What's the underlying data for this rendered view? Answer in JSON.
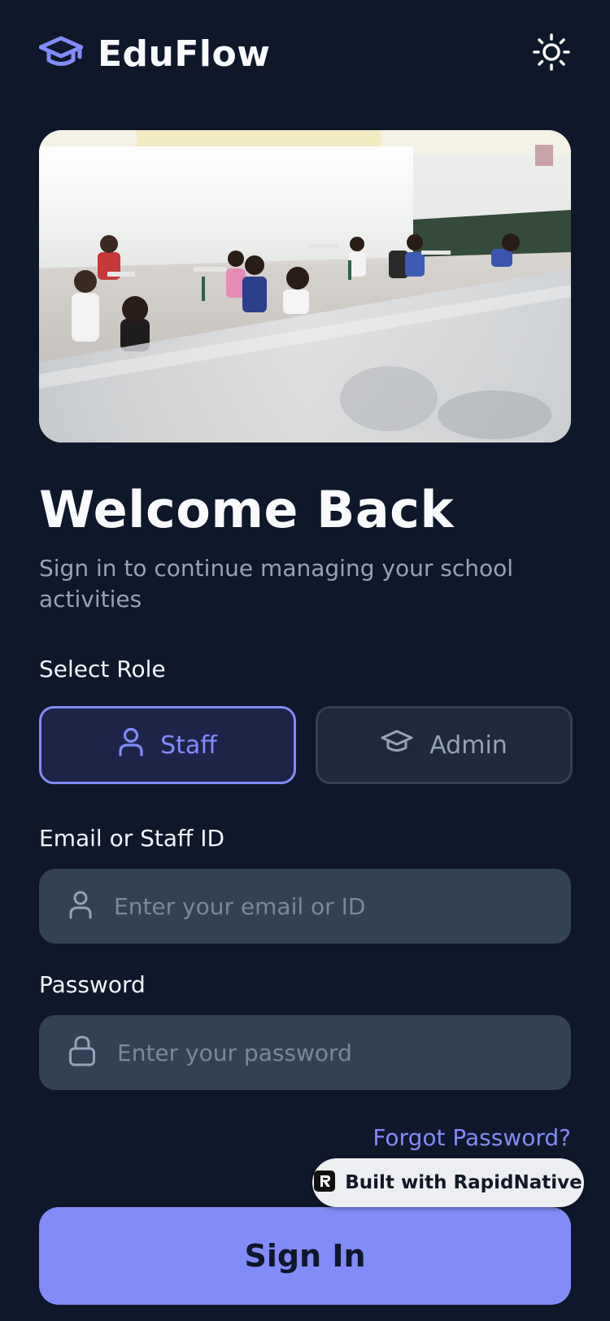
{
  "app": {
    "name": "EduFlow"
  },
  "header": {
    "logo_icon": "graduation-cap-icon",
    "theme_icon": "sun-icon"
  },
  "welcome": {
    "title": "Welcome Back",
    "subtitle": "Sign in to continue managing your school activities"
  },
  "role": {
    "label": "Select Role",
    "options": [
      {
        "label": "Staff",
        "icon": "user-icon",
        "selected": true
      },
      {
        "label": "Admin",
        "icon": "graduation-cap-icon",
        "selected": false
      }
    ]
  },
  "email": {
    "label": "Email or Staff ID",
    "placeholder": "Enter your email or ID",
    "value": "",
    "icon": "user-icon"
  },
  "password": {
    "label": "Password",
    "placeholder": "Enter your password",
    "value": "",
    "icon": "lock-icon"
  },
  "forgot_label": "Forgot Password?",
  "badge": {
    "label": "Built with RapidNative",
    "icon": "rapidnative-logo-icon"
  },
  "signin_label": "Sign In",
  "colors": {
    "background": "#0f172a",
    "accent": "#818cf8",
    "input_bg": "#334155",
    "muted_text": "#94a3b8"
  }
}
